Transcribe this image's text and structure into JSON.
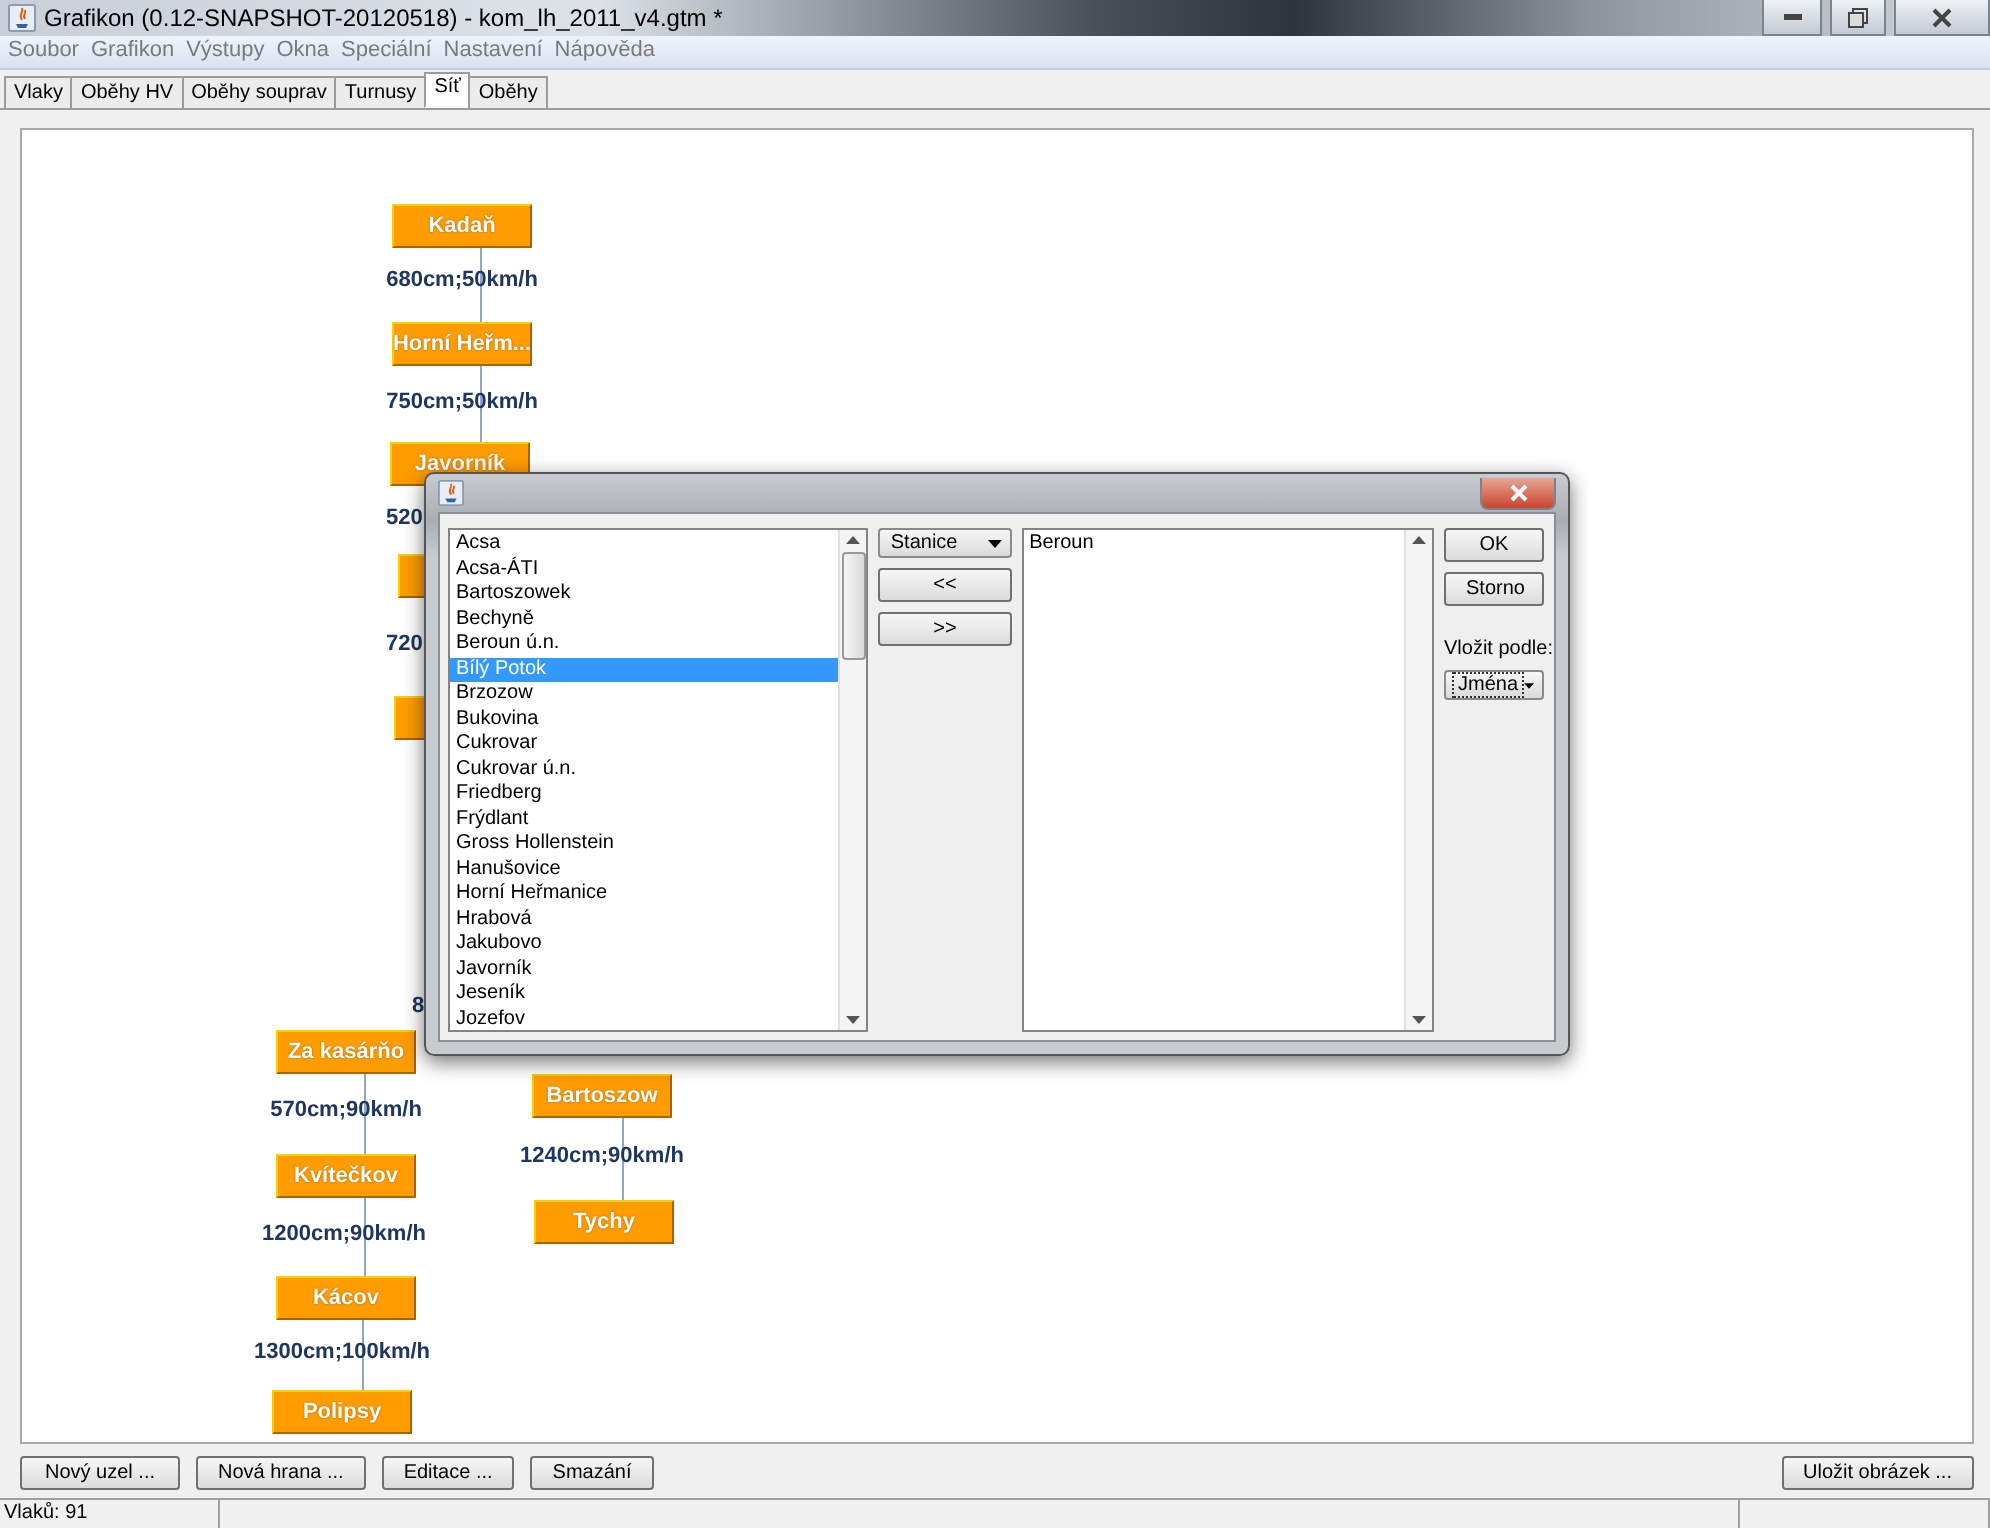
{
  "window": {
    "title": "Grafikon (0.12-SNAPSHOT-20120518) - kom_lh_2011_v4.gtm *"
  },
  "menu": [
    "Soubor",
    "Grafikon",
    "Výstupy",
    "Okna",
    "Speciální",
    "Nastavení",
    "Nápověda"
  ],
  "tabs": [
    {
      "label": "Vlaky",
      "selected": false
    },
    {
      "label": "Oběhy HV",
      "selected": false
    },
    {
      "label": "Oběhy souprav",
      "selected": false
    },
    {
      "label": "Turnusy",
      "selected": false
    },
    {
      "label": "Síť",
      "selected": true
    },
    {
      "label": "Oběhy",
      "selected": false
    }
  ],
  "network": {
    "nodes": [
      {
        "kind": "station",
        "label": "Kadaň"
      },
      {
        "kind": "station",
        "label": "Horní Heřm..."
      },
      {
        "kind": "station",
        "label": "Javorník"
      },
      {
        "kind": "covered"
      },
      {
        "kind": "covered"
      },
      {
        "kind": "station",
        "label": "Za kasárňo"
      },
      {
        "kind": "station",
        "label": "Kvítečkov"
      },
      {
        "kind": "station",
        "label": "Kácov"
      },
      {
        "kind": "station",
        "label": "Polipsy"
      },
      {
        "kind": "station",
        "label": "Bartoszow"
      },
      {
        "kind": "station",
        "label": "Tychy"
      }
    ],
    "edges": [
      {
        "label": "680cm;50km/h"
      },
      {
        "label": "750cm;50km/h"
      },
      {
        "label": "520"
      },
      {
        "label": "720"
      },
      {
        "label": "8"
      },
      {
        "label": "570cm;90km/h"
      },
      {
        "label": "1200cm;90km/h"
      },
      {
        "label": "1300cm;100km/h"
      },
      {
        "label": "1240cm;90km/h"
      }
    ]
  },
  "buttons": [
    "Nový uzel ...",
    "Nová hrana ...",
    "Editace ...",
    "Smazání"
  ],
  "save_button": "Uložit obrázek ...",
  "status_bar": {
    "trains": "Vlaků: 91"
  },
  "dialog": {
    "available": [
      {
        "label": "Acsa",
        "selected": false
      },
      {
        "label": "Acsa-ÁTI",
        "selected": false
      },
      {
        "label": "Bartoszowek",
        "selected": false
      },
      {
        "label": "Bechyně",
        "selected": false
      },
      {
        "label": "Beroun ú.n.",
        "selected": false
      },
      {
        "label": "Bílý Potok",
        "selected": true
      },
      {
        "label": "Brzozow",
        "selected": false
      },
      {
        "label": "Bukovina",
        "selected": false
      },
      {
        "label": "Cukrovar",
        "selected": false
      },
      {
        "label": "Cukrovar ú.n.",
        "selected": false
      },
      {
        "label": "Friedberg",
        "selected": false
      },
      {
        "label": "Frýdlant",
        "selected": false
      },
      {
        "label": "Gross Hollenstein",
        "selected": false
      },
      {
        "label": "Hanušovice",
        "selected": false
      },
      {
        "label": "Horní Heřmanice",
        "selected": false
      },
      {
        "label": "Hrabová",
        "selected": false
      },
      {
        "label": "Jakubovo",
        "selected": false
      },
      {
        "label": "Javorník",
        "selected": false
      },
      {
        "label": "Jeseník",
        "selected": false
      },
      {
        "label": "Jozefov",
        "selected": false
      }
    ],
    "type_select": "Stanice",
    "add_button": "<<",
    "remove_button": ">>",
    "chosen": [
      {
        "label": "Beroun",
        "selected": false
      }
    ],
    "ok": "OK",
    "cancel": "Storno",
    "insert_label": "Vložit podle:",
    "insert_select": "Jména"
  }
}
